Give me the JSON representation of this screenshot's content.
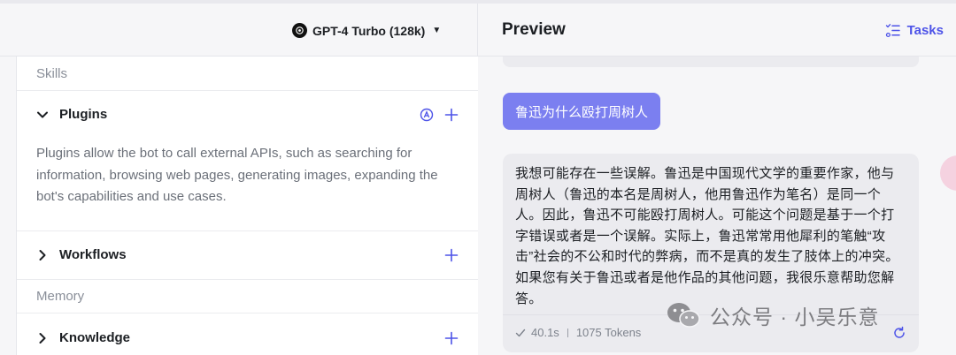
{
  "model_selector": {
    "label": "GPT-4 Turbo (128k)",
    "icon": "openai-icon"
  },
  "left": {
    "skills_label": "Skills",
    "plugins": {
      "title": "Plugins",
      "description": "Plugins allow the bot to call external APIs, such as searching for information, browsing web pages, generating images, expanding the bot's capabilities and use cases."
    },
    "workflows": {
      "title": "Workflows"
    },
    "memory_label": "Memory",
    "knowledge": {
      "title": "Knowledge"
    }
  },
  "right": {
    "title": "Preview",
    "tasks_label": "Tasks",
    "user_message": "鲁迅为什么殴打周树人",
    "bot_message": "我想可能存在一些误解。鲁迅是中国现代文学的重要作家，他与周树人（鲁迅的本名是周树人，他用鲁迅作为笔名）是同一个人。因此，鲁迅不可能殴打周树人。可能这个问题是基于一个打字错误或者是一个误解。实际上，鲁迅常常用他犀利的笔触“攻击”社会的不公和时代的弊病，而不是真的发生了肢体上的冲突。如果您有关于鲁迅或者是他作品的其他问题，我很乐意帮助您解答。",
    "latency": "40.1s",
    "tokens": "1075 Tokens"
  },
  "watermark": "公众号 · 小吴乐意",
  "colors": {
    "accent": "#4d53e8",
    "user_bubble": "#7b7ff0",
    "bot_bubble": "#ebebef"
  }
}
